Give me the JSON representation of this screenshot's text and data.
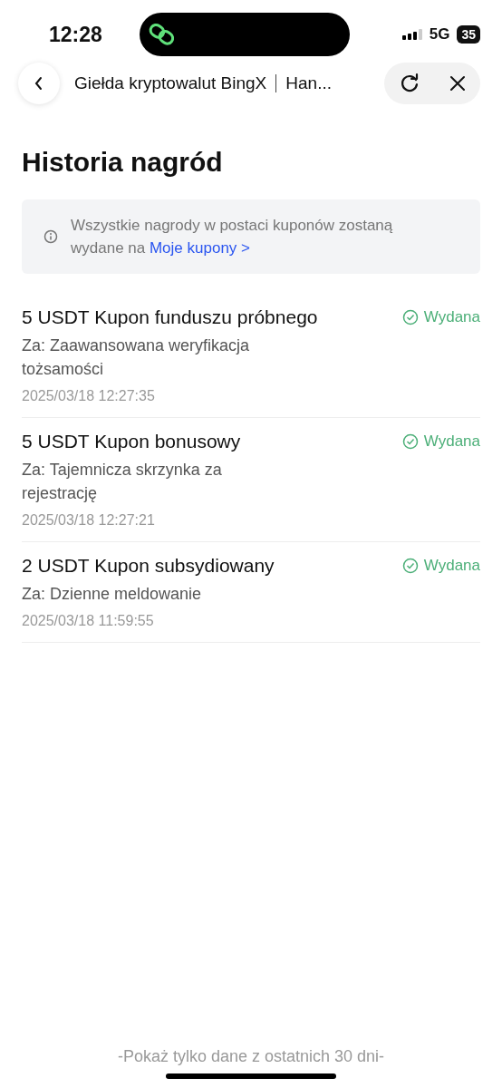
{
  "status_bar": {
    "time": "12:28",
    "network": "5G",
    "battery": "35"
  },
  "nav": {
    "title": "Giełda kryptowalut BingX",
    "subtitle": "Han..."
  },
  "heading": "Historia nagród",
  "notice": {
    "text": "Wszystkie nagrody w postaci kuponów zostaną wydane na",
    "link": "Moje kupony >"
  },
  "rewards": [
    {
      "title": "5 USDT Kupon funduszu próbnego",
      "reason": "Za: Zaawansowana weryfikacja tożsamości",
      "date": "2025/03/18 12:27:35",
      "status": {
        "kind": "issued",
        "label": "Wydana"
      }
    },
    {
      "title": "5 USDT Kupon bonusowy",
      "reason": "Za: Tajemnicza skrzynka za rejestrację",
      "date": "2025/03/18 12:27:21",
      "status": {
        "kind": "issued",
        "label": "Wydana"
      }
    },
    {
      "title": "2 USDT Kupon subsydiowany",
      "reason": "Za: Dzienne meldowanie",
      "date": "2025/03/18 11:59:55",
      "status": {
        "kind": "issued",
        "label": "Wydana"
      }
    }
  ],
  "footer": "-Pokaż tylko dane z ostatnich 30 dni-"
}
